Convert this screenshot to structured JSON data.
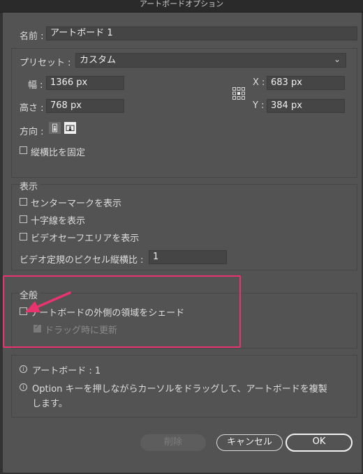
{
  "window": {
    "title": "アートボードオプション"
  },
  "name": {
    "label": "名前 :",
    "value": "アートボード 1"
  },
  "preset": {
    "label": "プリセット :",
    "value": "カスタム"
  },
  "size": {
    "width_label": "幅 :",
    "width_value": "1366 px",
    "height_label": "高さ :",
    "height_value": "768 px",
    "x_label": "X :",
    "x_value": "683 px",
    "y_label": "Y :",
    "y_value": "384 px"
  },
  "orientation": {
    "label": "方向 :"
  },
  "lock_ratio": {
    "label": "縦横比を固定",
    "checked": false
  },
  "display": {
    "section_title": "表示",
    "center_mark": "センターマークを表示",
    "cross_hairs": "十字線を表示",
    "video_safe": "ビデオセーフエリアを表示",
    "video_ratio_label": "ビデオ定規のピクセル縦横比 :",
    "video_ratio_value": "1"
  },
  "general": {
    "section_title": "全般",
    "fade_outside": "アートボードの外側の領域をシェード",
    "update_drag": "ドラッグ時に更新"
  },
  "info": {
    "artboards": "アートボード : 1",
    "tip_line1": "Option キーを押しながらカーソルをドラッグして、アートボードを複製",
    "tip_line2": "します。"
  },
  "buttons": {
    "delete": "削除",
    "cancel": "キャンセル",
    "ok": "OK"
  },
  "colors": {
    "annotation": "#e8336e",
    "dialog_bg": "#535353"
  },
  "icons": [
    "portrait-orientation-icon",
    "landscape-orientation-icon",
    "reference-point-icon",
    "info-icon",
    "annotation-arrow"
  ]
}
